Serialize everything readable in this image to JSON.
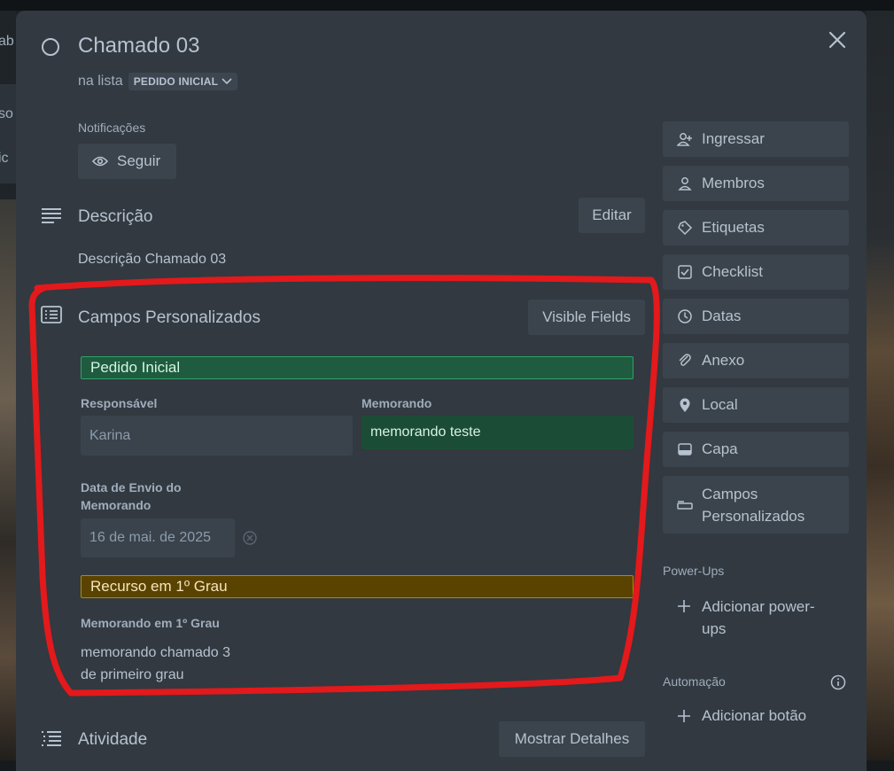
{
  "background": {
    "left_text_1": "ab",
    "left_text_2": "so",
    "left_text_3": "ic"
  },
  "card": {
    "title": "Chamado 03",
    "in_list_prefix": "na lista",
    "list_name": "PEDIDO INICIAL"
  },
  "notifications": {
    "label": "Notificações",
    "follow_button": "Seguir"
  },
  "description": {
    "title": "Descrição",
    "edit_button": "Editar",
    "text": "Descrição Chamado 03"
  },
  "custom_fields": {
    "title": "Campos Personalizados",
    "visible_fields_button": "Visible Fields",
    "group_1": {
      "title": "Pedido Inicial",
      "color": "#1f5b3e",
      "border": "#2ea26b"
    },
    "responsavel": {
      "label": "Responsável",
      "value": "Karina"
    },
    "memorando": {
      "label": "Memorando",
      "value": "memorando teste",
      "color": "#1b4d36"
    },
    "data_envio": {
      "label_line1": "Data de Envio do",
      "label_line2": "Memorando",
      "value": "16 de mai. de 2025"
    },
    "group_2": {
      "title": "Recurso em 1º Grau",
      "color": "#5a4300",
      "border": "#b38a00"
    },
    "memorando_1grau": {
      "label": "Memorando em 1º Grau",
      "value_line1": "memorando chamado 3",
      "value_line2": "de primeiro grau"
    }
  },
  "activity": {
    "title": "Atividade",
    "details_button": "Mostrar Detalhes"
  },
  "sidebar": {
    "items": [
      {
        "label": "Ingressar",
        "icon": "add-person-icon"
      },
      {
        "label": "Membros",
        "icon": "person-icon"
      },
      {
        "label": "Etiquetas",
        "icon": "tag-icon"
      },
      {
        "label": "Checklist",
        "icon": "checkbox-icon"
      },
      {
        "label": "Datas",
        "icon": "clock-icon"
      },
      {
        "label": "Anexo",
        "icon": "paperclip-icon"
      },
      {
        "label": "Local",
        "icon": "location-pin-icon"
      },
      {
        "label": "Capa",
        "icon": "card-cover-icon"
      }
    ],
    "custom_fields_line1": "Campos",
    "custom_fields_line2": "Personalizados",
    "powerups_label": "Power-Ups",
    "add_powerups_line1": "Adicionar power-",
    "add_powerups_line2": "ups",
    "automation_label": "Automação",
    "add_button": "Adicionar botão"
  },
  "annotation": {
    "color": "#e3191c"
  }
}
